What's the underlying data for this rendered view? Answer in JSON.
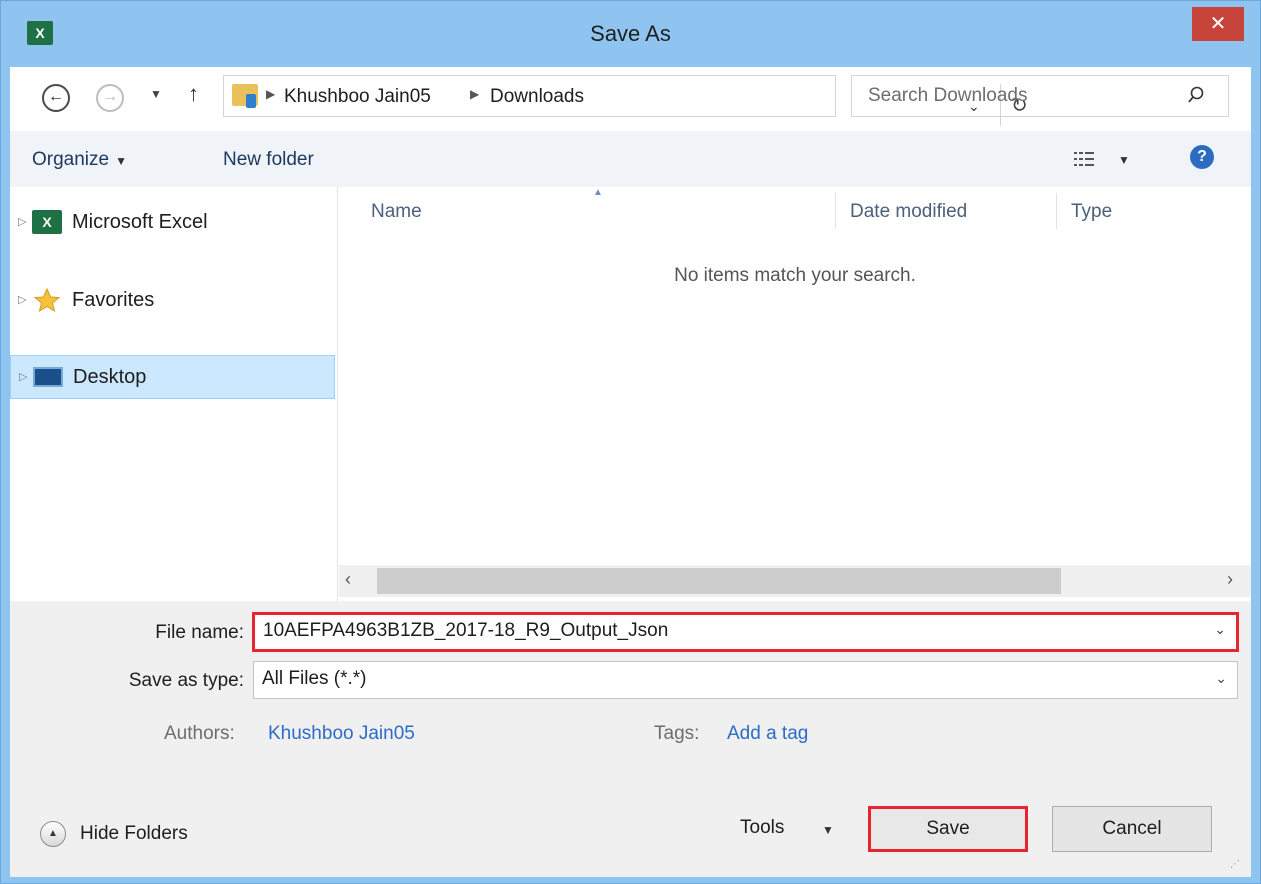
{
  "window": {
    "title": "Save As",
    "app_icon": "X",
    "close_symbol": "✕"
  },
  "address": {
    "crumbs": [
      "Khushboo Jain05",
      "Downloads"
    ],
    "search_placeholder": "Search Downloads"
  },
  "toolbar": {
    "organize_label": "Organize",
    "new_folder_label": "New folder",
    "help_symbol": "?"
  },
  "nav_pane": {
    "items": [
      {
        "label": "Microsoft Excel",
        "icon": "excel-icon",
        "selected": false
      },
      {
        "label": "Favorites",
        "icon": "star-icon",
        "selected": false
      },
      {
        "label": "Desktop",
        "icon": "desktop-icon",
        "selected": true
      }
    ]
  },
  "file_list": {
    "columns": [
      "Name",
      "Date modified",
      "Type"
    ],
    "empty_message": "No items match your search."
  },
  "form": {
    "file_name_label": "File name:",
    "file_name_value": "10AEFPA4963B1ZB_2017-18_R9_Output_Json",
    "save_type_label": "Save as type:",
    "save_type_value": "All Files (*.*)",
    "authors_label": "Authors:",
    "authors_value": "Khushboo Jain05",
    "tags_label": "Tags:",
    "tags_value": "Add a tag"
  },
  "footer": {
    "hide_folders_label": "Hide Folders",
    "tools_label": "Tools",
    "save_label": "Save",
    "cancel_label": "Cancel"
  },
  "colors": {
    "title_bar": "#8fc4f1",
    "close_button": "#c7443a",
    "highlight_border": "#e5262f",
    "link": "#2c6cc7",
    "selection": "#cce8ff"
  }
}
